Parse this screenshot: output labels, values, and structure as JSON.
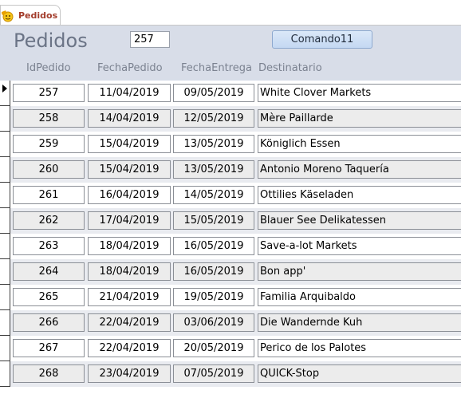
{
  "tab": {
    "label": "Pedidos",
    "icon": "form-icon"
  },
  "header": {
    "title": "Pedidos",
    "id_value": "257",
    "command_label": "Comando11",
    "columns": [
      "IdPedido",
      "FechaPedido",
      "FechaEntrega",
      "Destinatario"
    ]
  },
  "rows": [
    {
      "id": "257",
      "fecha_pedido": "11/04/2019",
      "fecha_entrega": "09/05/2019",
      "destinatario": "White Clover Markets"
    },
    {
      "id": "258",
      "fecha_pedido": "14/04/2019",
      "fecha_entrega": "12/05/2019",
      "destinatario": "Mère Paillarde"
    },
    {
      "id": "259",
      "fecha_pedido": "15/04/2019",
      "fecha_entrega": "13/05/2019",
      "destinatario": "Königlich Essen"
    },
    {
      "id": "260",
      "fecha_pedido": "15/04/2019",
      "fecha_entrega": "13/05/2019",
      "destinatario": "Antonio Moreno Taquería"
    },
    {
      "id": "261",
      "fecha_pedido": "16/04/2019",
      "fecha_entrega": "14/05/2019",
      "destinatario": "Ottilies Käseladen"
    },
    {
      "id": "262",
      "fecha_pedido": "17/04/2019",
      "fecha_entrega": "15/05/2019",
      "destinatario": "Blauer See Delikatessen"
    },
    {
      "id": "263",
      "fecha_pedido": "18/04/2019",
      "fecha_entrega": "16/05/2019",
      "destinatario": "Save-a-lot Markets"
    },
    {
      "id": "264",
      "fecha_pedido": "18/04/2019",
      "fecha_entrega": "16/05/2019",
      "destinatario": "Bon app'"
    },
    {
      "id": "265",
      "fecha_pedido": "21/04/2019",
      "fecha_entrega": "19/05/2019",
      "destinatario": "Familia Arquibaldo"
    },
    {
      "id": "266",
      "fecha_pedido": "22/04/2019",
      "fecha_entrega": "03/06/2019",
      "destinatario": "Die Wandernde Kuh"
    },
    {
      "id": "267",
      "fecha_pedido": "22/04/2019",
      "fecha_entrega": "20/05/2019",
      "destinatario": "Perico de los Palotes"
    },
    {
      "id": "268",
      "fecha_pedido": "23/04/2019",
      "fecha_entrega": "07/05/2019",
      "destinatario": "QUICK-Stop"
    }
  ],
  "current_record_index": 0
}
